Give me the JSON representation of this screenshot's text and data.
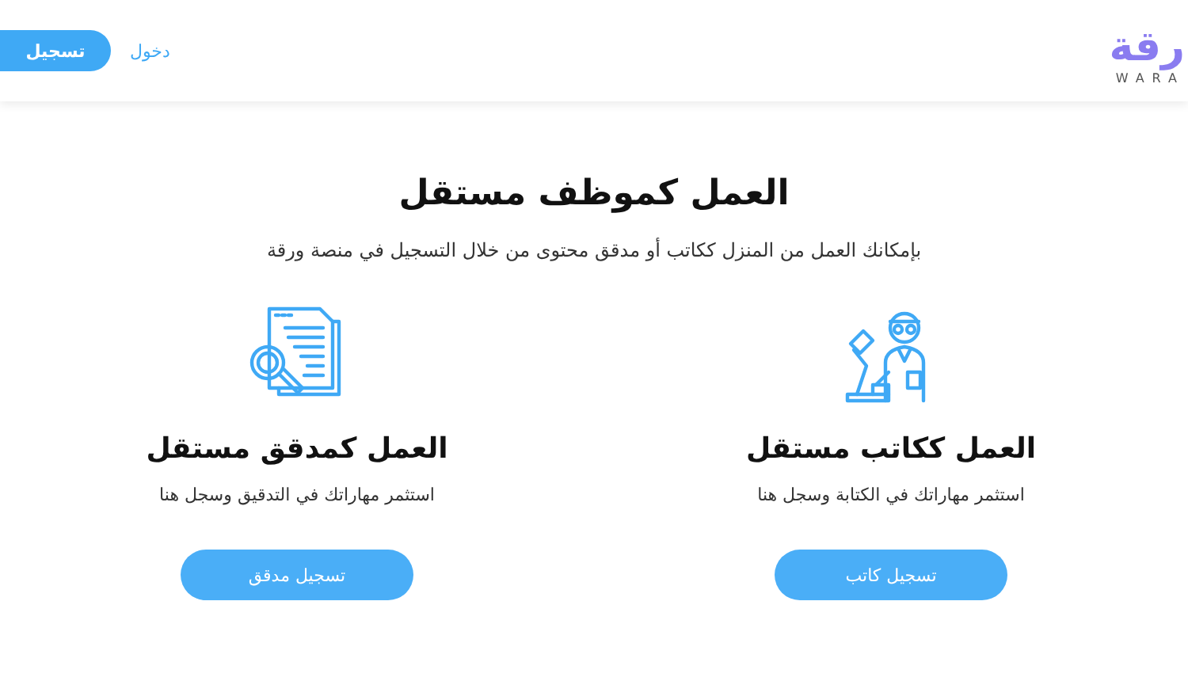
{
  "header": {
    "logo": {
      "text": "رقة",
      "subtitle": "WARA"
    },
    "login_link": "دخول",
    "register_button": "تسجيل"
  },
  "hero": {
    "title": "العمل كموظف مستقل",
    "subtitle": "بإمكانك العمل من المنزل ككاتب أو مدقق محتوى من خلال التسجيل في منصة ورقة"
  },
  "cards": [
    {
      "kind": "writer",
      "title": "العمل ككاتب مستقل",
      "description": "استثمر مهاراتك في الكتابة وسجل هنا",
      "button": "تسجيل كاتب"
    },
    {
      "kind": "proofreader",
      "title": "العمل كمدقق مستقل",
      "description": "استثمر مهاراتك في التدقيق وسجل هنا",
      "button": "تسجيل مدقق"
    }
  ]
}
